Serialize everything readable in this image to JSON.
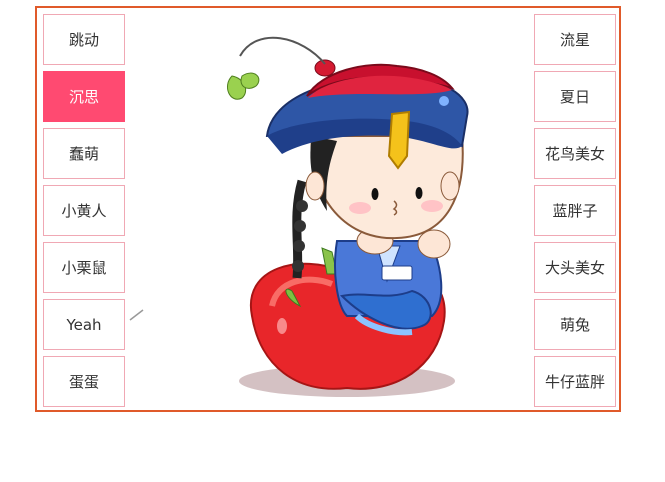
{
  "left_menu": [
    {
      "label": "跳动",
      "active": false
    },
    {
      "label": "沉思",
      "active": true
    },
    {
      "label": "蠢萌",
      "active": false
    },
    {
      "label": "小黄人",
      "active": false
    },
    {
      "label": "小栗鼠",
      "active": false
    },
    {
      "label": "Yeah",
      "active": false
    },
    {
      "label": "蛋蛋",
      "active": false
    }
  ],
  "right_menu": [
    {
      "label": "流星",
      "active": false
    },
    {
      "label": "夏日",
      "active": false
    },
    {
      "label": "花鸟美女",
      "active": false
    },
    {
      "label": "蓝胖子",
      "active": false
    },
    {
      "label": "大头美女",
      "active": false
    },
    {
      "label": "萌兔",
      "active": false
    },
    {
      "label": "牛仔蓝胖",
      "active": false
    }
  ],
  "colors": {
    "frame": "#e05a2a",
    "active": "#ff4a71",
    "button_border": "#f0a8b4"
  },
  "illustration": "cartoon-qing-boy-sitting-on-apple"
}
